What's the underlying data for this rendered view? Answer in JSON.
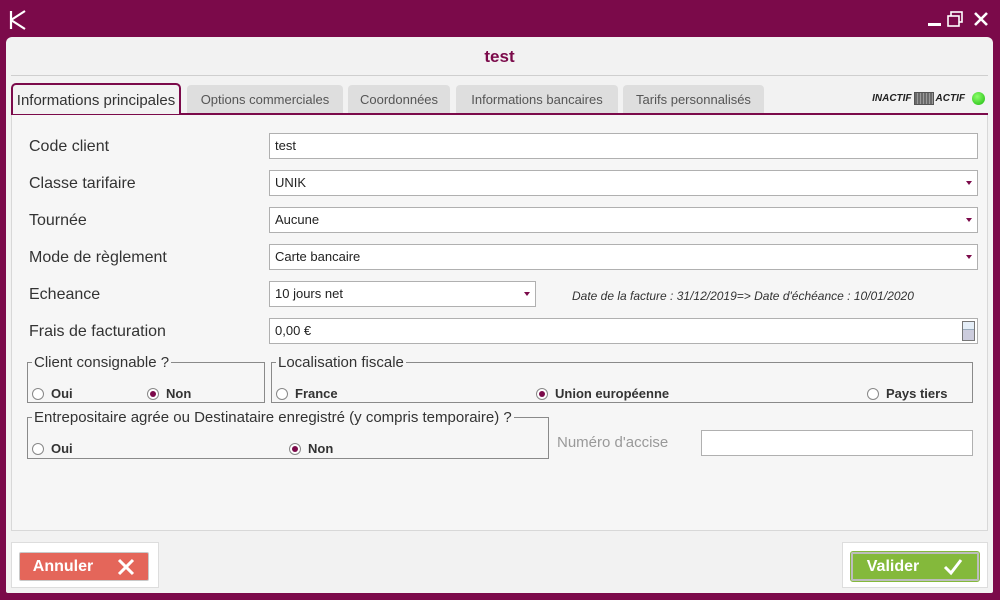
{
  "app": {
    "logo_letter": "K"
  },
  "window": {
    "title": "test"
  },
  "tabs": [
    {
      "label": "Informations principales"
    },
    {
      "label": "Options commerciales"
    },
    {
      "label": "Coordonnées"
    },
    {
      "label": "Informations bancaires"
    },
    {
      "label": "Tarifs personnalisés"
    }
  ],
  "status": {
    "inactive_label": "INACTIF",
    "active_label": "ACTIF",
    "state": "actif",
    "led_color": "#1db90e"
  },
  "form": {
    "code_client": {
      "label": "Code client",
      "value": "test"
    },
    "classe_tarifaire": {
      "label": "Classe tarifaire",
      "value": "UNIK"
    },
    "tournee": {
      "label": "Tournée",
      "value": "Aucune"
    },
    "mode_reglement": {
      "label": "Mode de règlement",
      "value": "Carte bancaire"
    },
    "echeance": {
      "label": "Echeance",
      "value": "10 jours net",
      "hint": "Date de la facture : 31/12/2019=> Date d'échéance : 10/01/2020"
    },
    "frais_facturation": {
      "label": "Frais de facturation",
      "value": "0,00 €"
    }
  },
  "client_consignable": {
    "legend": "Client consignable ?",
    "options": [
      "Oui",
      "Non"
    ],
    "selected": "Non"
  },
  "localisation_fiscale": {
    "legend": "Localisation fiscale",
    "options": [
      "France",
      "Union européenne",
      "Pays tiers"
    ],
    "selected": "Union européenne"
  },
  "entrepositaire": {
    "legend": "Entrepositaire agrée ou Destinataire enregistré (y compris temporaire) ?",
    "options": [
      "Oui",
      "Non"
    ],
    "selected": "Non"
  },
  "numero_accise": {
    "label": "Numéro d'accise",
    "value": ""
  },
  "buttons": {
    "cancel": "Annuler",
    "validate": "Valider"
  },
  "colors": {
    "brand": "#7b0a4a",
    "cancel": "#e4665a",
    "validate": "#84b93b"
  }
}
